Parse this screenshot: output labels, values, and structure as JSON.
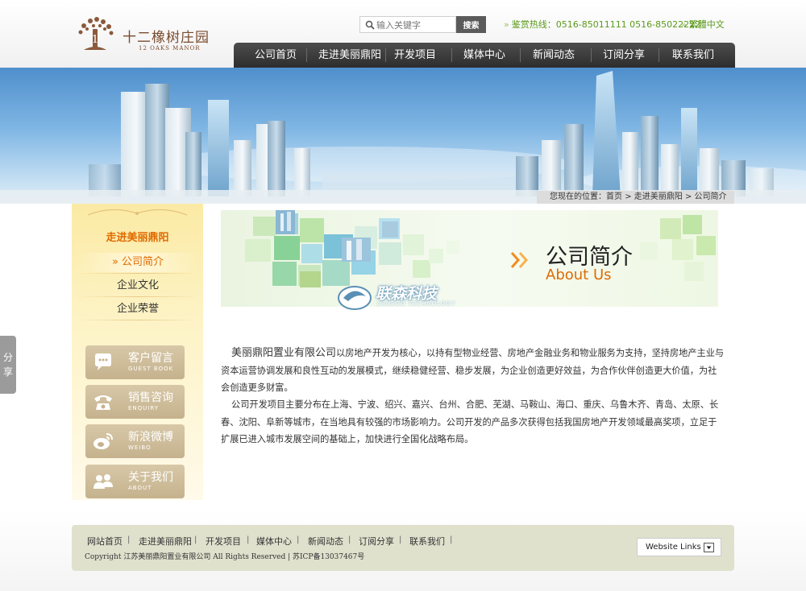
{
  "logo": {
    "cn": "十二橡树庄园",
    "en": "12 OAKS MANOR"
  },
  "search": {
    "placeholder": "输入关键字",
    "button": "搜索"
  },
  "hotline": {
    "label": "鉴赏热线：0516-85011111  0516-85022222"
  },
  "language": {
    "traditional": "繁體",
    "simplified": "中文"
  },
  "nav": {
    "items": [
      "公司首页",
      "走进美丽鼎阳",
      "开发项目",
      "媒体中心",
      "新闻动态",
      "订阅分享",
      "联系我们"
    ]
  },
  "breadcrumb": {
    "prefix": "您现在的位置：",
    "home": "首页",
    "section": "走进美丽鼎阳",
    "current": "公司简介",
    "sep": ">"
  },
  "sidebar": {
    "title": "走进美丽鼎阳",
    "items": [
      {
        "label": "» 公司简介",
        "active": true
      },
      {
        "label": "企业文化",
        "active": false
      },
      {
        "label": "企业荣誉",
        "active": false
      }
    ],
    "buttons": [
      {
        "cn": "客户留言",
        "en": "GUEST BOOK",
        "icon": "speech-bubble-icon"
      },
      {
        "cn": "销售咨询",
        "en": "ENQUIRY",
        "icon": "telephone-icon"
      },
      {
        "cn": "新浪微博",
        "en": "WEIBO",
        "icon": "weibo-icon"
      },
      {
        "cn": "关于我们",
        "en": "ABOUT",
        "icon": "people-icon"
      }
    ]
  },
  "share_tab": {
    "label": "分享"
  },
  "hero": {
    "title_cn": "公司简介",
    "title_en": "About Us"
  },
  "watermark": {
    "text": "联森科技",
    "sub": "LANSOO TECHNOLOGY"
  },
  "content": {
    "p1_company": "美丽鼎阳置业有限公司",
    "p1_rest": "以房地产开发为核心，以持有型物业经营、房地产金融业务和物业服务为支持，坚持房地产主业与资本运营协调发展和良性互动的发展模式，继续稳健经营、稳步发展，为企业创造更好效益，为合作伙伴创造更大价值，为社会创造更多财富。",
    "p2": "公司开发项目主要分布在上海、宁波、绍兴、嘉兴、台州、合肥、芜湖、马鞍山、海口、重庆、乌鲁木齐、青岛、太原、长春、沈阳、阜新等城市，在当地具有较强的市场影响力。公司开发的产品多次获得包括我国房地产开发领域最高奖项，立足于扩展已进入城市发展空间的基础上，加快进行全国化战略布局。"
  },
  "footer": {
    "links": [
      "网站首页",
      "走进美丽鼎阳",
      "开发项目",
      "媒体中心",
      "新闻动态",
      "订阅分享",
      "联系我们"
    ],
    "sep": "|",
    "copyright_pre": "Copyright ",
    "copyright_company": "江苏美丽鼎阳置业有限公司",
    "copyright_post": " All Rights Reserved | 苏ICP备13037467号",
    "weblinks": "Website Links"
  },
  "colors": {
    "accent": "#e06a00",
    "nav_bg": "#3a3a3a",
    "hotline": "#5b9a1b",
    "footer_bg": "#dfe1cd"
  }
}
